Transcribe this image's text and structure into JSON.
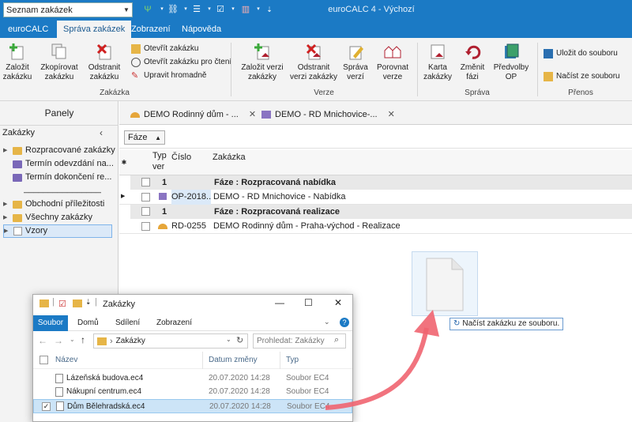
{
  "app": {
    "title": "euroCALC 4 - Výchozí",
    "search_combo": "Seznam zakázek"
  },
  "tabs": [
    "euroCALC",
    "Správa zakázek",
    "Zobrazení",
    "Nápověda"
  ],
  "ribbon": {
    "zakazka": {
      "zalozit": [
        "Založit",
        "zakázku"
      ],
      "zkopirovat": [
        "Zkopírovat",
        "zakázku"
      ],
      "odstranit": [
        "Odstranit",
        "zakázku"
      ],
      "otevrit": "Otevřít zakázku",
      "otevrit_cteni": "Otevřít zakázku pro čtení",
      "upravit": "Upravit hromadně",
      "group": "Zakázka"
    },
    "verze": {
      "zalozit": [
        "Založit verzi",
        "zakázky"
      ],
      "odstranit": [
        "Odstranit",
        "verzi zakázky"
      ],
      "sprava": [
        "Správa",
        "verzí"
      ],
      "porovnat": [
        "Porovnat",
        "verze"
      ],
      "group": "Verze"
    },
    "sprava": {
      "karta": [
        "Karta",
        "zakázky"
      ],
      "zmenit": [
        "Změnit",
        "fázi"
      ],
      "predvolby": [
        "Předvolby",
        "OP"
      ],
      "group": "Správa"
    },
    "prenos": {
      "ulozit": "Uložit do souboru",
      "nacist": "Načíst ze souboru",
      "group": "Přenos"
    }
  },
  "panel": {
    "title": "Panely",
    "section": "Zakázky",
    "items": [
      "Rozpracované zakázky",
      "Termín odevzdání na...",
      "Termín dokončení re...",
      "________________",
      "Obchodní příležitosti",
      "Všechny zakázky",
      "Vzory"
    ]
  },
  "doctabs": [
    "DEMO Rodinný dům - ...",
    "DEMO - RD Mnichovice-..."
  ],
  "grid": {
    "filter": "Fáze",
    "headers": {
      "typ": "Typ",
      "ver": "ver",
      "cislo": "Číslo",
      "zakazka": "Zakázka"
    },
    "groups": [
      {
        "count": "1",
        "label": "Fáze : Rozpracovaná nabídka",
        "row": {
          "cislo": "OP-2018...",
          "zakazka": "DEMO - RD Mnichovice - Nabídka"
        }
      },
      {
        "count": "1",
        "label": "Fáze : Rozpracovaná realizace",
        "row": {
          "cislo": "RD-0255",
          "zakazka": "DEMO Rodinný dům - Praha-východ - Realizace"
        }
      }
    ]
  },
  "drag_tooltip": "Načíst zakázku ze souboru.",
  "explorer": {
    "title": "Zakázky",
    "tabs": [
      "Soubor",
      "Domů",
      "Sdílení",
      "Zobrazení"
    ],
    "path": "Zakázky",
    "search_placeholder": "Prohledat: Zakázky",
    "columns": {
      "name": "Název",
      "date": "Datum změny",
      "type": "Typ"
    },
    "files": [
      {
        "name": "Lázeňská budova.ec4",
        "date": "20.07.2020 14:28",
        "type": "Soubor EC4"
      },
      {
        "name": "Nákupní centrum.ec4",
        "date": "20.07.2020 14:28",
        "type": "Soubor EC4"
      },
      {
        "name": "Dům Bělehradská.ec4",
        "date": "20.07.2020 14:28",
        "type": "Soubor EC4"
      }
    ]
  },
  "colors": {
    "accent": "#1b7ac5",
    "arrow": "#f06470",
    "group_row": "#e8e8e8",
    "selected": "#cce4f7"
  }
}
